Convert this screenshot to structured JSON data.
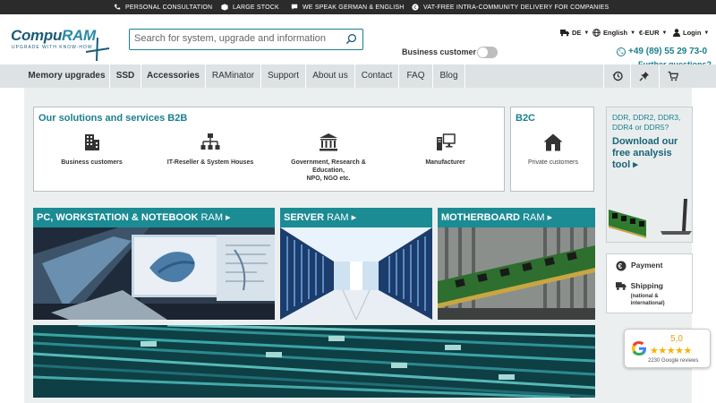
{
  "topbar": {
    "items": [
      {
        "label": "PERSONAL CONSULTATION",
        "icon": "phone-icon"
      },
      {
        "label": "LARGE STOCK",
        "icon": "box-icon"
      },
      {
        "label": "WE SPEAK GERMAN & ENGLISH",
        "icon": "chat-icon"
      },
      {
        "label": "VAT-FREE INTRA-COMMUNITY DELIVERY FOR COMPANIES",
        "icon": "euro-icon"
      }
    ]
  },
  "header": {
    "logo_main": "Compu",
    "logo_accent": "RAM",
    "logo_tagline": "UPGRADE WITH KNOW-HOW",
    "search_placeholder": "Search for system, upgrade and information",
    "business_customer": "Business customer",
    "country": "DE",
    "language": "English",
    "currency": "€-EUR",
    "login": "Login",
    "phone": "+49 (89) 55 29 73-0",
    "further_questions": "Further questions?"
  },
  "nav": {
    "items": [
      "Memory upgrades",
      "SSD",
      "Accessories",
      "RAMinator",
      "Support",
      "About us",
      "Contact",
      "FAQ",
      "Blog"
    ]
  },
  "b2b": {
    "title": "Our solutions and services B2B",
    "services": [
      {
        "line1": "Business customers",
        "line2": "",
        "line3": "",
        "icon": "building-icon"
      },
      {
        "line1": "IT-Reseller & System Houses",
        "line2": "",
        "line3": "",
        "icon": "network-icon"
      },
      {
        "line1": "Government, Research &",
        "line2": "Education,",
        "line3": "NPO, NGO etc.",
        "icon": "government-icon"
      },
      {
        "line1": "Manufacturer",
        "line2": "",
        "line3": "",
        "icon": "workstation-icon"
      }
    ]
  },
  "b2c": {
    "title": "B2C",
    "service": "Private customers"
  },
  "tiles": [
    {
      "bold": "PC, WORKSTATION & NOTEBOOK",
      "light": "RAM ▸"
    },
    {
      "bold": "SERVER",
      "light": "RAM ▸"
    },
    {
      "bold": "MOTHERBOARD",
      "light": "RAM ▸"
    }
  ],
  "ddr": {
    "question": "DDR, DDR2, DDR3, DDR4 or DDR5?",
    "cta": "Download our free analysis tool ▸"
  },
  "side": {
    "payment": "Payment",
    "shipping": "Shipping",
    "shipping_sub": "(national & international)"
  },
  "google": {
    "score": "5,0",
    "stars": "★★★★★",
    "reviews": "2230 Google reviews"
  },
  "colors": {
    "accent": "#1a7f8e",
    "tile_label": "#1b8b94",
    "topbar": "#2b2b2b",
    "nav": "#dde2e4"
  }
}
